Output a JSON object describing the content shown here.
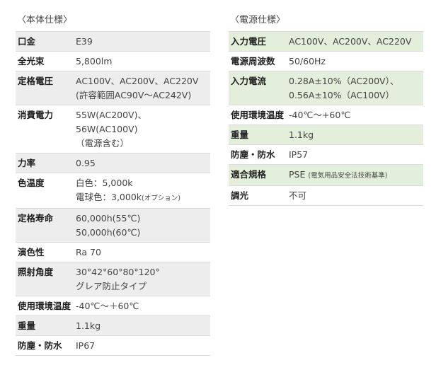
{
  "left_spec": {
    "title": "〈本体仕様〉",
    "rows": [
      {
        "label": "口金",
        "lines": [
          "E39"
        ]
      },
      {
        "label": "全光束",
        "lines": [
          "5,800lm"
        ]
      },
      {
        "label": "定格電圧",
        "lines": [
          "AC100V、AC200V、AC220V",
          "(許容範囲AC90V～AC242V)"
        ]
      },
      {
        "label": "消費電力",
        "lines": [
          "55W(AC200V)、",
          "56W(AC100V)",
          "（電源含む）"
        ]
      },
      {
        "label": "力率",
        "lines": [
          "0.95"
        ]
      },
      {
        "label": "色温度",
        "lines": [
          "白色：5,000k"
        ],
        "extra_line": {
          "main": "電球色：3,000k",
          "note": "(オプション)"
        }
      },
      {
        "label": "定格寿命",
        "lines": [
          "60,000h(55℃)",
          "50,000h(60℃)"
        ]
      },
      {
        "label": "演色性",
        "lines": [
          "Ra 70"
        ]
      },
      {
        "label": "照射角度",
        "lines": [
          "30°42°60°80°120°",
          "グレア防止タイプ"
        ]
      },
      {
        "label": "使用環境温度",
        "lines": [
          "-40℃～＋60℃"
        ]
      },
      {
        "label": "重量",
        "lines": [
          "1.1kg"
        ]
      },
      {
        "label": "防塵・防水",
        "lines": [
          "IP67"
        ]
      }
    ]
  },
  "right_spec": {
    "title": "〈電源仕様〉",
    "rows": [
      {
        "label": "入力電圧",
        "lines": [
          "AC100V、AC200V、AC220V"
        ]
      },
      {
        "label": "電源周波数",
        "lines": [
          "50/60Hz"
        ]
      },
      {
        "label": "入力電流",
        "lines": [
          "0.28A±10%（AC200V）、",
          "0.56A±10%（AC100V）"
        ]
      },
      {
        "label": "使用環境温度",
        "lines": [
          "-40℃～+60℃"
        ]
      },
      {
        "label": "重量",
        "lines": [
          "1.1kg"
        ]
      },
      {
        "label": "防塵・防水",
        "lines": [
          "IP57"
        ]
      },
      {
        "label": "適合規格",
        "lines": [
          "PSE"
        ],
        "note": "(電気用品安全法技術基準)"
      },
      {
        "label": "調光",
        "lines": [
          "不可"
        ]
      }
    ]
  },
  "colors": {
    "row_shade_gray": "#ededed",
    "row_shade_green": "#e3eedb",
    "border": "#dadada"
  }
}
